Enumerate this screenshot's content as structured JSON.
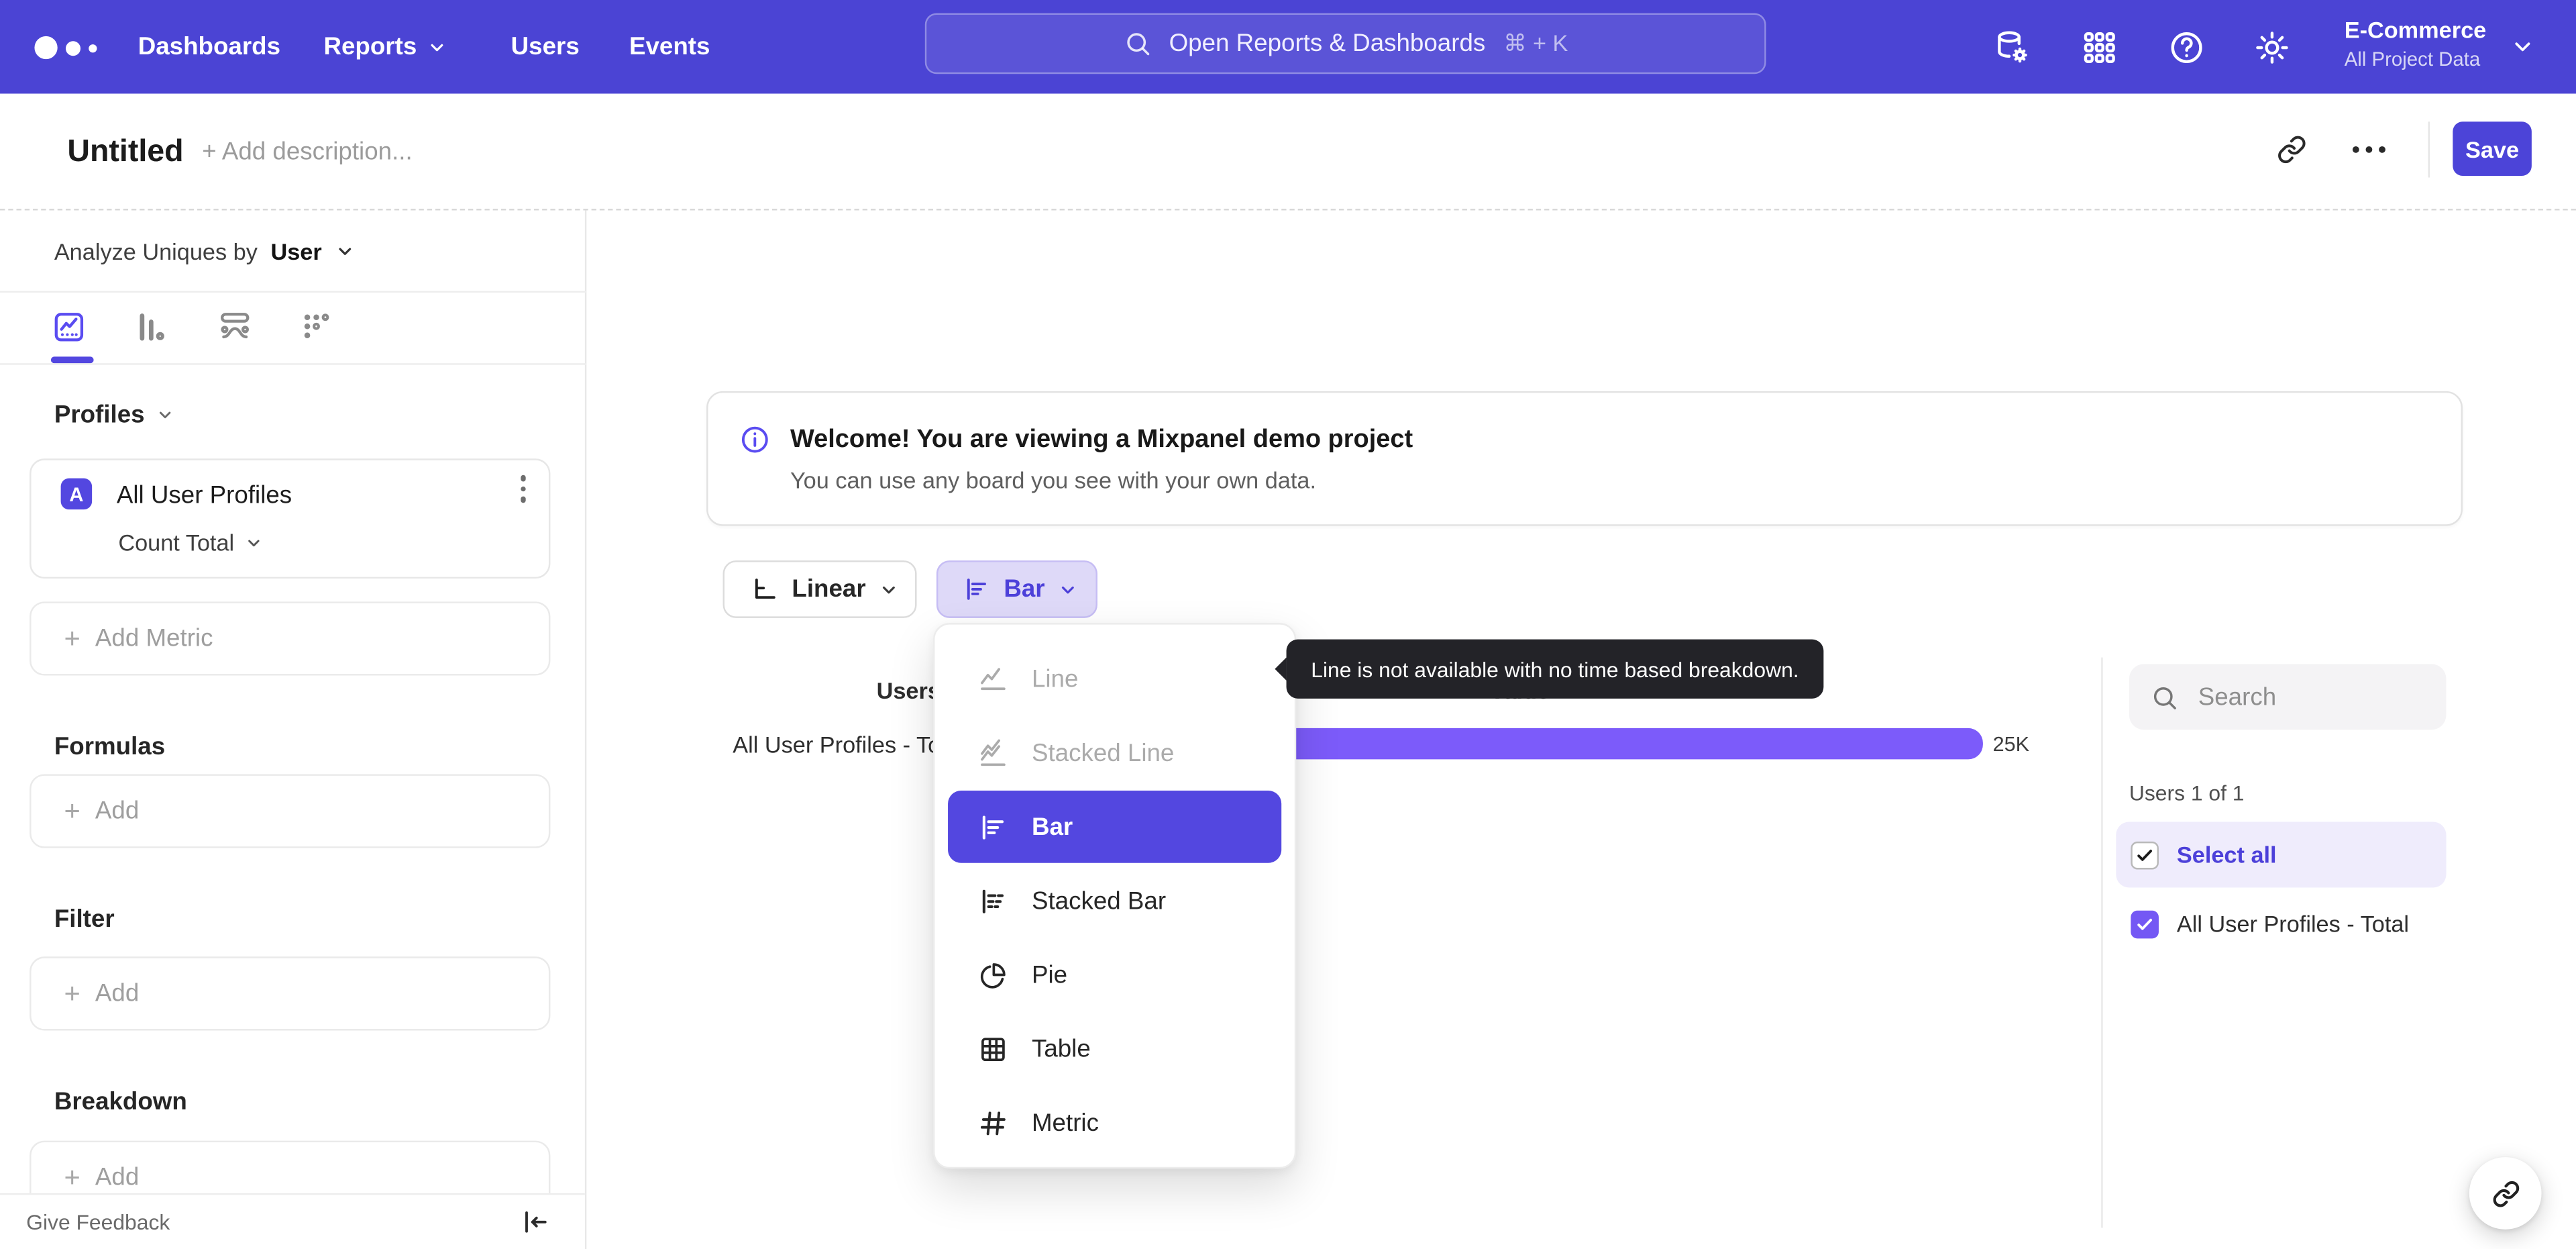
{
  "topnav": {
    "nav_items": [
      "Dashboards",
      "Reports",
      "Users",
      "Events"
    ],
    "search_placeholder": "Open Reports & Dashboards",
    "search_shortcut": "⌘ + K",
    "project_name": "E-Commerce",
    "project_scope": "All Project Data"
  },
  "header": {
    "title": "Untitled",
    "add_description": "+ Add description...",
    "save_label": "Save"
  },
  "sidebar": {
    "analyze_label": "Analyze Uniques by",
    "analyze_value": "User",
    "profiles_label": "Profiles",
    "metric": {
      "badge": "A",
      "name": "All User Profiles",
      "aggregation": "Count Total"
    },
    "add_metric_label": "Add Metric",
    "plus": "+",
    "sections": [
      {
        "title": "Formulas",
        "add_label": "Add"
      },
      {
        "title": "Filter",
        "add_label": "Add"
      },
      {
        "title": "Breakdown",
        "add_label": "Add"
      }
    ],
    "give_feedback": "Give Feedback"
  },
  "banner": {
    "title": "Welcome! You are viewing a Mixpanel demo project",
    "subtitle": "You can use any board you see with your own data."
  },
  "controls": {
    "scale": "Linear",
    "chart_type": "Bar"
  },
  "dropdown": {
    "items": [
      {
        "label": "Line",
        "state": "disabled"
      },
      {
        "label": "Stacked Line",
        "state": "disabled"
      },
      {
        "label": "Bar",
        "state": "selected"
      },
      {
        "label": "Stacked Bar",
        "state": "normal"
      },
      {
        "label": "Pie",
        "state": "normal"
      },
      {
        "label": "Table",
        "state": "normal"
      },
      {
        "label": "Metric",
        "state": "normal"
      }
    ]
  },
  "tooltip": {
    "text": "Line is not available with no time based breakdown."
  },
  "chart": {
    "col_users": "Users",
    "col_value": "Value",
    "row_label": "All User Profiles - Total",
    "value_label": "25K"
  },
  "right_panel": {
    "search_placeholder": "Search",
    "count_label": "Users 1 of 1",
    "select_all_label": "Select all",
    "item_label": "All User Profiles - Total"
  },
  "chart_data": {
    "type": "bar",
    "orientation": "horizontal",
    "categories": [
      "All User Profiles - Total"
    ],
    "values": [
      25000
    ],
    "value_labels": [
      "25K"
    ],
    "columns": [
      "Users",
      "Value"
    ],
    "series_color": "#7c5bfa"
  },
  "colors": {
    "nav_bg": "#4b44d4",
    "accent": "#5347e0",
    "bar_fill": "#7c5bfa",
    "chip_bg": "#ded9f8",
    "checkbox_fill": "#7458f4",
    "tooltip_bg": "#232328"
  }
}
